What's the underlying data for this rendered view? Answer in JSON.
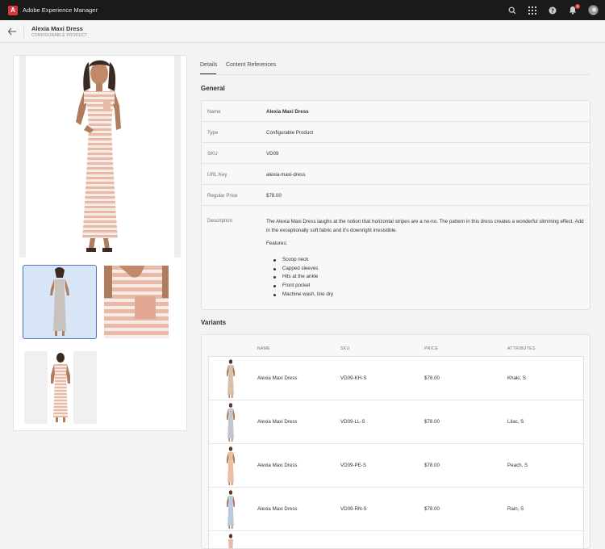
{
  "app": {
    "title": "Adobe Experience Manager",
    "logo_letter": "A",
    "notification_count": "3"
  },
  "header": {
    "product_name": "Alexia Maxi Dress",
    "product_type_label": "CONFIGURABLE PRODUCT"
  },
  "tabs": [
    {
      "label": "Details",
      "active": true
    },
    {
      "label": "Content References",
      "active": false
    }
  ],
  "general": {
    "title": "General",
    "rows": [
      {
        "label": "Name",
        "value": "Alexia Maxi Dress"
      },
      {
        "label": "Type",
        "value": "Configurable Product"
      },
      {
        "label": "SKU",
        "value": "VD09"
      },
      {
        "label": "URL Key",
        "value": "alexia-maxi-dress"
      },
      {
        "label": "Regular Price",
        "value": "$78.00"
      }
    ],
    "description_label": "Description",
    "description": "The Alexia Maxi Dress laughs at the notion that horizontal stripes are a no-no. The pattern in this dress creates a wonderful slimming effect. Add in the exceptionally soft fabric and it's downright irresistible.",
    "features_label": "Features:",
    "features": [
      "Scoop neck",
      "Capped sleeves",
      "Hits at the ankle",
      "Front pocket",
      "Machine wash, line dry"
    ]
  },
  "variants": {
    "title": "Variants",
    "columns": [
      "NAME",
      "SKU",
      "PRICE",
      "ATTRIBUTES"
    ],
    "rows": [
      {
        "name": "Alexia Maxi Dress",
        "sku": "VD09-KH-S",
        "price": "$78.00",
        "attributes": "Khaki, S",
        "color": "#d9c0aa"
      },
      {
        "name": "Alexia Maxi Dress",
        "sku": "VD09-LL-S",
        "price": "$78.00",
        "attributes": "Lilac, S",
        "color": "#c3c6cf"
      },
      {
        "name": "Alexia Maxi Dress",
        "sku": "VD09-PE-S",
        "price": "$78.00",
        "attributes": "Peach, S",
        "color": "#ecbfa3"
      },
      {
        "name": "Alexia Maxi Dress",
        "sku": "VD09-RN-S",
        "price": "$78.00",
        "attributes": "Rain, S",
        "color": "#b8cbe0"
      }
    ]
  },
  "colors": {
    "dress_stripe": "#e9b9a8",
    "dress_base": "#f7ece5",
    "skin": "#b07c5e",
    "hair": "#3b2a22",
    "selected_thumb_border": "#4b75c4"
  }
}
